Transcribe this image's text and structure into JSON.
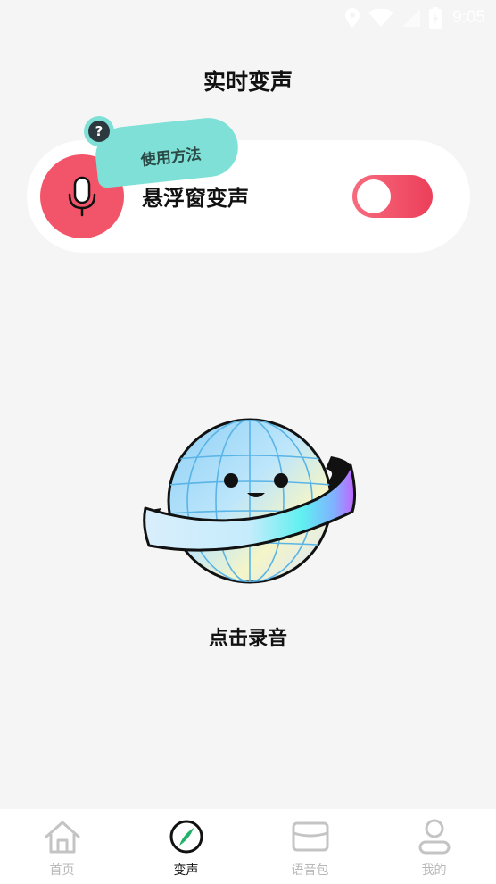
{
  "status_bar": {
    "time": "9:05",
    "icons": [
      "location-icon",
      "wifi-icon",
      "signal-icon",
      "battery-charging-icon"
    ]
  },
  "header": {
    "title": "实时变声"
  },
  "float_window": {
    "label": "悬浮窗变声",
    "icon": "microphone-icon",
    "toggle_state": "off",
    "usage_tip": "使用方法",
    "help_icon": "question-icon",
    "help_glyph": "?"
  },
  "main": {
    "mascot": "planet-mascot",
    "record_label": "点击录音"
  },
  "tabs": [
    {
      "label": "首页",
      "icon": "home-icon",
      "active": false
    },
    {
      "label": "变声",
      "icon": "compass-icon",
      "active": true
    },
    {
      "label": "语音包",
      "icon": "folder-icon",
      "active": false
    },
    {
      "label": "我的",
      "icon": "user-icon",
      "active": false
    }
  ],
  "colors": {
    "accent_red": "#f25569",
    "toggle_red": "#ec3f5a",
    "tip_teal": "#7ee0d6",
    "background": "#f5f5f5"
  }
}
